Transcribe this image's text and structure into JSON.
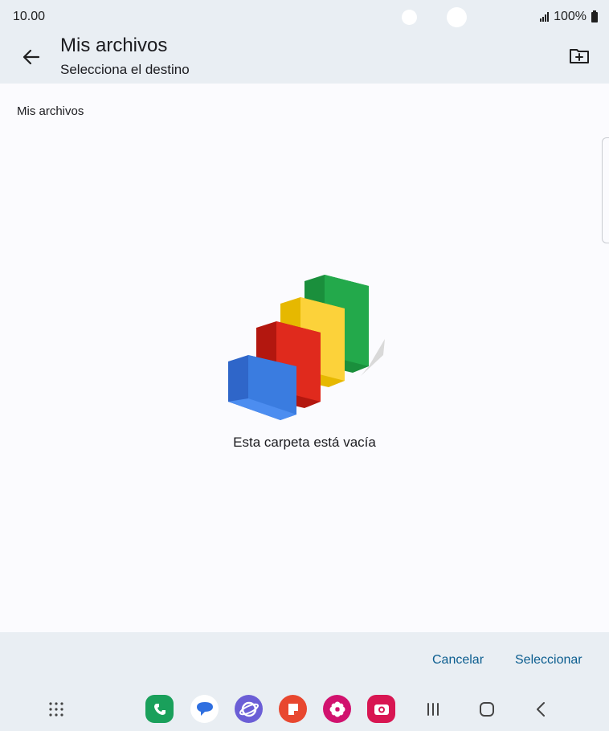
{
  "status_bar": {
    "time": "10.00",
    "battery": "100%"
  },
  "app_bar": {
    "title": "Mis archivos",
    "subtitle": "Selecciona el destino"
  },
  "content": {
    "breadcrumb": "Mis archivos",
    "empty_message": "Esta carpeta está vacía"
  },
  "actions": {
    "cancel_label": "Cancelar",
    "select_label": "Seleccionar"
  },
  "navbar": {
    "apps": [
      {
        "name": "phone-app-icon",
        "color": "#1aa05b"
      },
      {
        "name": "messages-app-icon",
        "color": "#ffffff"
      },
      {
        "name": "internet-app-icon",
        "color": "#6b5ed6"
      },
      {
        "name": "notes-app-icon",
        "color": "#e8472f"
      },
      {
        "name": "gallery-app-icon",
        "color": "#d1126e"
      },
      {
        "name": "camera-app-icon",
        "color": "#d81652"
      }
    ]
  },
  "colors": {
    "accent": "#0b5d8f",
    "surface": "#fbfbfe",
    "bar": "#e9eef3"
  }
}
